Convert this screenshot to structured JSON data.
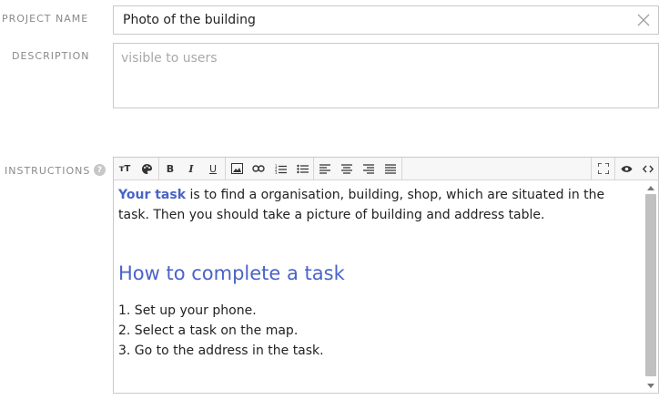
{
  "project_name": {
    "label": "PROJECT NAME",
    "value": "Photo of the building"
  },
  "description": {
    "label": "DESCRIPTION",
    "placeholder": "visible to users"
  },
  "instructions": {
    "label": "INSTRUCTIONS",
    "help_glyph": "?",
    "toolbar": {
      "text_size": "тT",
      "bold": "B",
      "italic": "I",
      "underline": "U"
    },
    "content": {
      "intro_strong": "Your task",
      "intro_rest": " is to find a organisation, building, shop, which are situated in the task. Then you should take a picture of building and address table.",
      "heading": "How to complete a task",
      "steps": [
        "1. Set up your phone.",
        "2. Select a task on the map.",
        "3. Go to the address in the task."
      ]
    }
  },
  "colors": {
    "accent": "#4a63c9",
    "border": "#c9c9c9",
    "label": "#8a8a8a"
  }
}
